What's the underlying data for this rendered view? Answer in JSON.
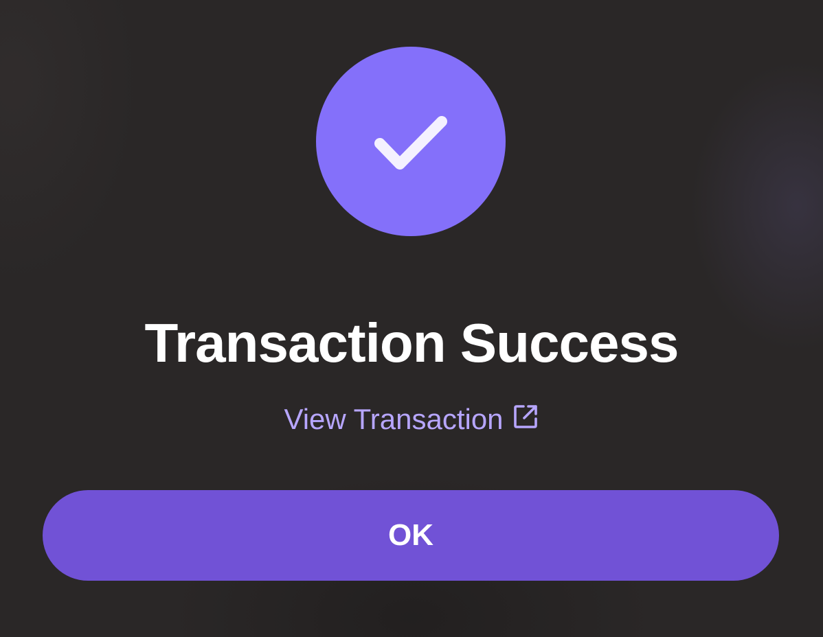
{
  "dialog": {
    "status_icon": "checkmark-icon",
    "title": "Transaction Success",
    "link": {
      "label": "View Transaction",
      "icon": "external-link-icon"
    },
    "ok_button_label": "OK"
  },
  "colors": {
    "background": "#2a2727",
    "accent_circle": "#8470fa",
    "button": "#7152d6",
    "link": "#b7a6ff",
    "title": "#ffffff"
  }
}
